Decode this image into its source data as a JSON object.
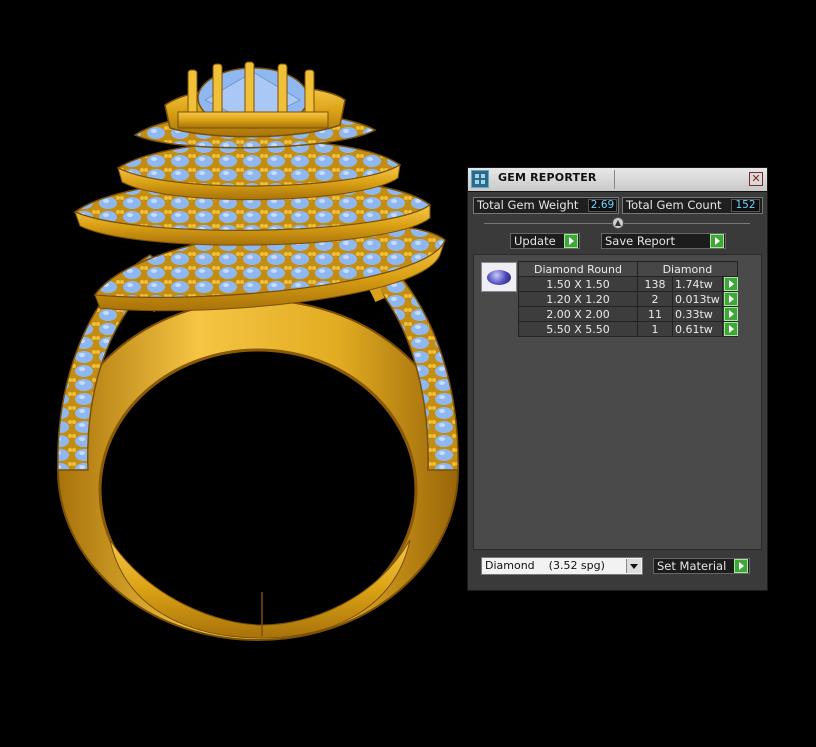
{
  "panel": {
    "title": "GEM REPORTER",
    "close_glyph": "✕",
    "totals": {
      "weight_label": "Total Gem Weight",
      "weight_value": "2.69",
      "count_label": "Total Gem Count",
      "count_value": "152"
    },
    "buttons": {
      "update": "Update",
      "save_report": "Save Report",
      "set_material": "Set Material"
    },
    "table": {
      "headers": [
        "Diamond Round",
        "Diamond"
      ],
      "rows": [
        {
          "size": "1.50 X 1.50",
          "count": "138",
          "weight": "1.74tw"
        },
        {
          "size": "1.20 X 1.20",
          "count": "2",
          "weight": "0.013tw"
        },
        {
          "size": "2.00 X 2.00",
          "count": "11",
          "weight": "0.33tw"
        },
        {
          "size": "5.50 X 5.50",
          "count": "1",
          "weight": "0.61tw"
        }
      ]
    },
    "material_select": "Diamond    (3.52 spg)",
    "icons": {
      "app": "gem-reporter-icon",
      "thumbnail": "round-gem-thumbnail",
      "arrow": "play-arrow-icon",
      "dropdown": "chevron-down-icon"
    }
  },
  "colors": {
    "gold": "#e3aa1d",
    "gem_blue": "#8fb8f0",
    "background": "#000000",
    "panel": "#3a3a3a",
    "value_cyan": "#6fd3ff",
    "arrow_green": "#3fa63a"
  }
}
